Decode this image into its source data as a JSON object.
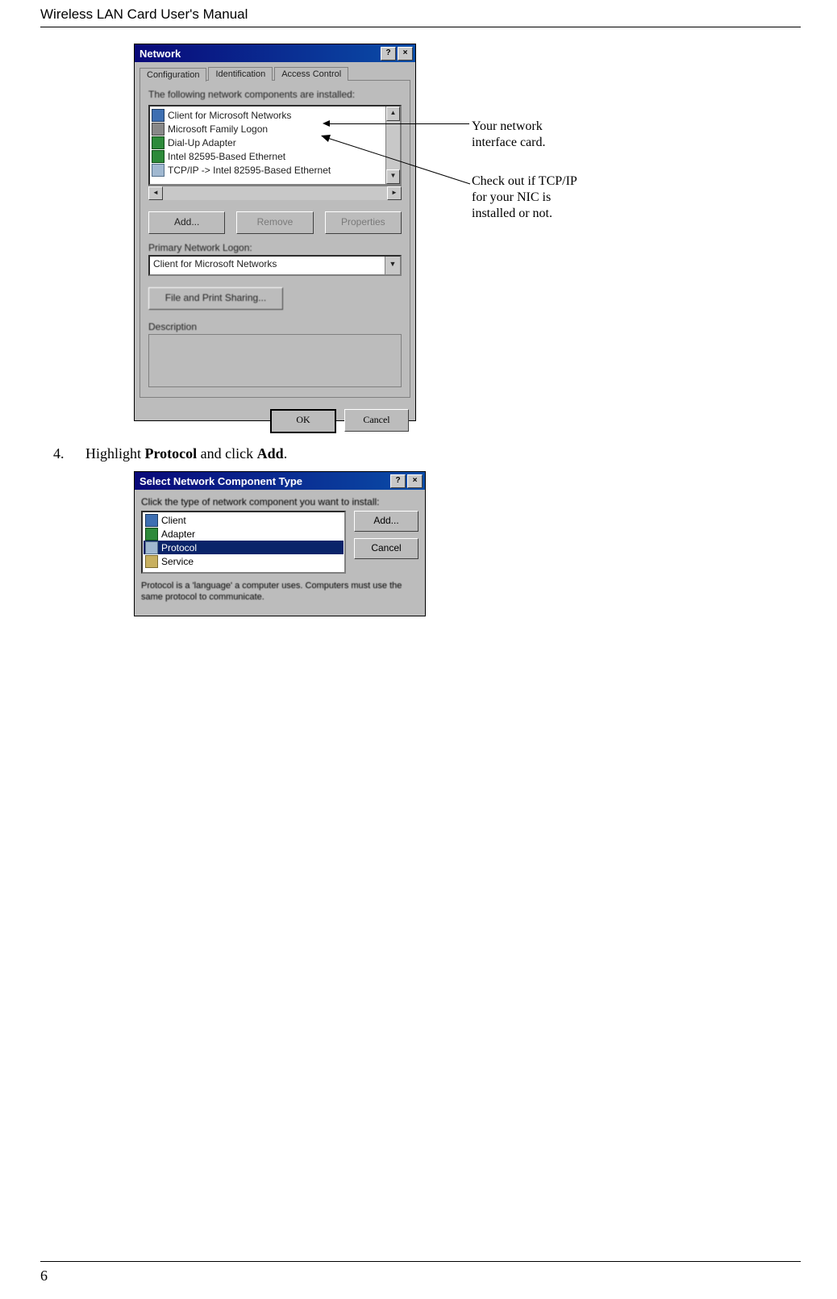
{
  "header": "Wireless LAN Card User's Manual",
  "page_number": "6",
  "annotations": {
    "nic": "Your network\ninterface card.",
    "tcpip": "Check out if TCP/IP\nfor your NIC is\ninstalled or not."
  },
  "step4": {
    "num": "4.",
    "text_pre": "Highlight ",
    "text_b1": "Protocol",
    "text_mid": " and click ",
    "text_b2": "Add",
    "text_post": "."
  },
  "network_dialog": {
    "title": "Network",
    "help_btn": "?",
    "close_btn": "×",
    "tabs": [
      "Configuration",
      "Identification",
      "Access Control"
    ],
    "intro": "The following network components are installed:",
    "components": [
      {
        "icon": "computer",
        "label": "Client for Microsoft Networks"
      },
      {
        "icon": "logon",
        "label": "Microsoft Family Logon"
      },
      {
        "icon": "adapter",
        "label": "Dial-Up Adapter"
      },
      {
        "icon": "adapter",
        "label": "Intel 82595-Based Ethernet"
      },
      {
        "icon": "protocol",
        "label": "TCP/IP -> Intel 82595-Based Ethernet"
      }
    ],
    "buttons": {
      "add": "Add...",
      "remove": "Remove",
      "properties": "Properties"
    },
    "primary_logon_label": "Primary Network Logon:",
    "primary_logon_value": "Client for Microsoft Networks",
    "file_print": "File and Print Sharing...",
    "description_label": "Description",
    "ok": "OK",
    "cancel": "Cancel"
  },
  "component_dialog": {
    "title": "Select Network Component Type",
    "help_btn": "?",
    "close_btn": "×",
    "intro": "Click the type of network component you want to install:",
    "types": [
      {
        "icon": "client",
        "label": "Client"
      },
      {
        "icon": "adapter",
        "label": "Adapter"
      },
      {
        "icon": "protocol",
        "label": "Protocol",
        "selected": true
      },
      {
        "icon": "service",
        "label": "Service"
      }
    ],
    "add": "Add...",
    "cancel": "Cancel",
    "desc": "Protocol is a 'language' a computer uses. Computers must use the same protocol to communicate."
  }
}
